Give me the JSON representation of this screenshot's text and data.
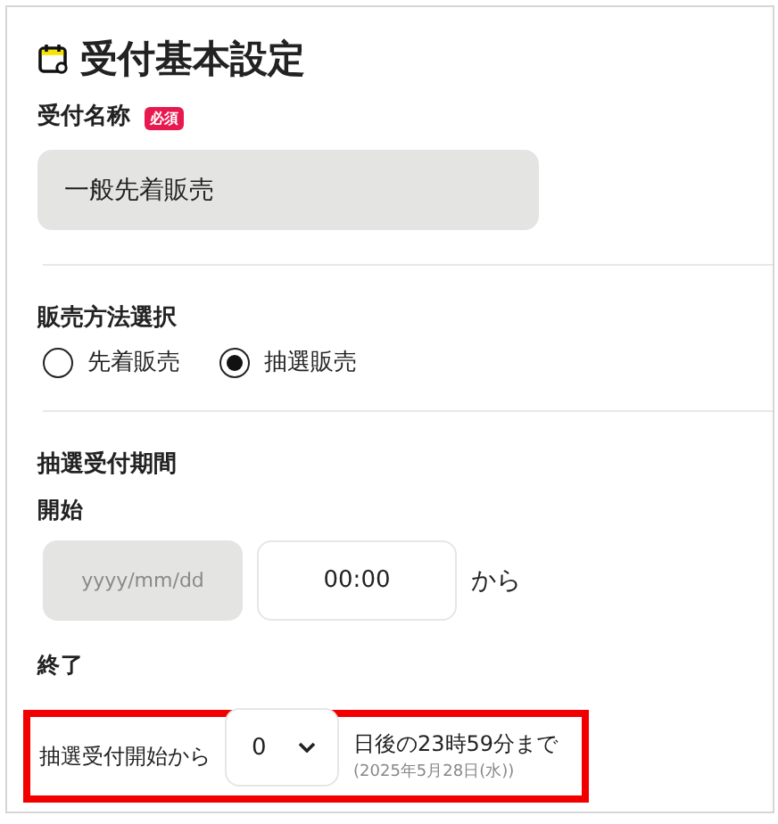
{
  "title": "受付基本設定",
  "name_field": {
    "label": "受付名称",
    "badge": "必須",
    "value": "一般先着販売",
    "disabled": true
  },
  "sales_method": {
    "label": "販売方法選択",
    "options": [
      {
        "label": "先着販売",
        "selected": false
      },
      {
        "label": "抽選販売",
        "selected": true
      }
    ]
  },
  "period": {
    "label": "抽選受付期間",
    "start": {
      "label": "開始",
      "date_placeholder": "yyyy/mm/dd",
      "date_disabled": true,
      "time": "00:00",
      "suffix": "から"
    },
    "end": {
      "label": "終了",
      "prefix": "抽選受付開始から",
      "days": "0",
      "suffix": "日後の23時59分まで",
      "note": "(2025年5月28日(水))",
      "highlighted": true
    }
  }
}
